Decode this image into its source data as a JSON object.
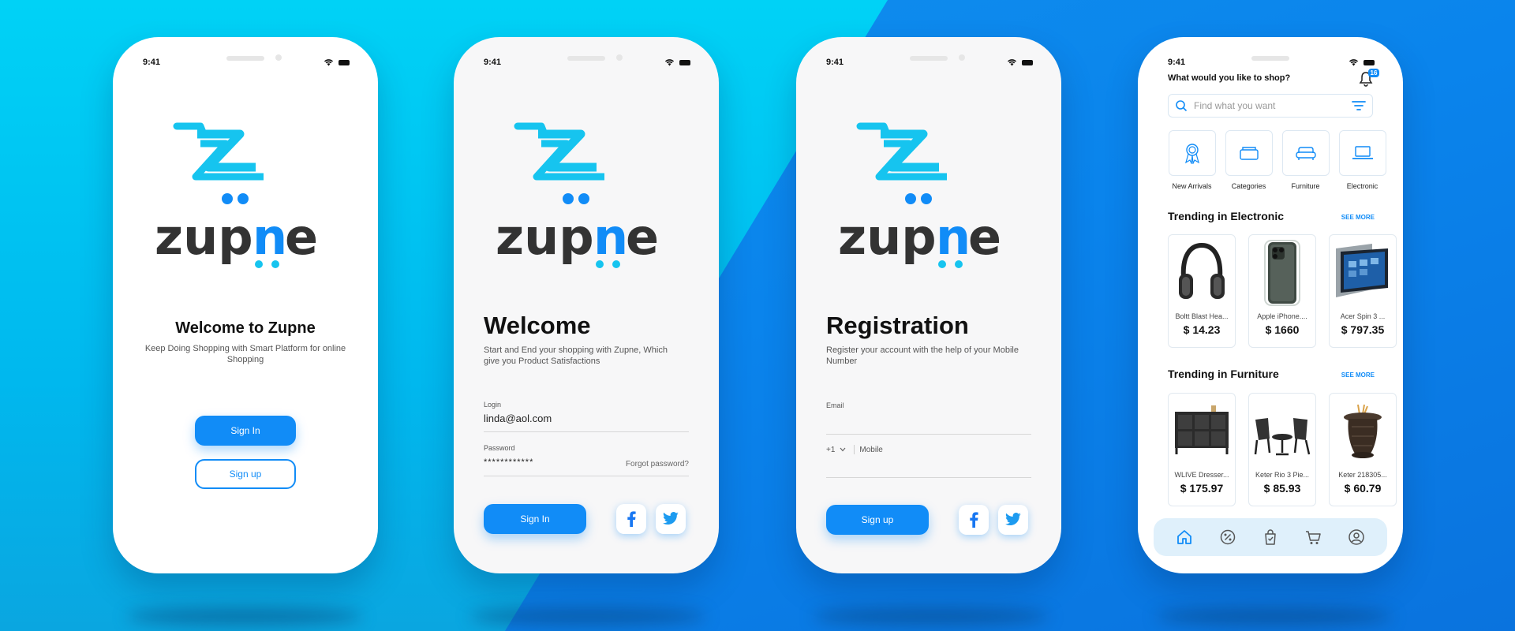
{
  "colors": {
    "accent": "#118cf7",
    "logo_cyan": "#16c4ef",
    "logo_dark": "#333333"
  },
  "status": {
    "time": "9:41"
  },
  "brand": {
    "name_start": "zup",
    "name_n": "n",
    "name_end": "e"
  },
  "welcome_screen": {
    "title": "Welcome to Zupne",
    "subtitle": "Keep Doing Shopping with Smart Platform for online Shopping",
    "sign_in": "Sign In",
    "sign_up": "Sign up"
  },
  "login_screen": {
    "title": "Welcome",
    "subtitle": "Start and End your shopping with Zupne, Which give you Product Satisfactions",
    "login_label": "Login",
    "login_value": "linda@aol.com",
    "password_label": "Password",
    "password_value": "************",
    "forgot": "Forgot password?",
    "sign_in": "Sign In",
    "facebook_icon": "facebook-icon",
    "twitter_icon": "twitter-icon"
  },
  "register_screen": {
    "title": "Registration",
    "subtitle": "Register your account with the help of your Mobile Number",
    "email_label": "Email",
    "country_code": "+1",
    "mobile_placeholder": "Mobile",
    "sign_up": "Sign up"
  },
  "shop_screen": {
    "question": "What would you like to shop?",
    "notification_count": "16",
    "search_placeholder": "Find what you want",
    "categories": [
      {
        "label": "New Arrivals",
        "icon": "award-icon"
      },
      {
        "label": "Categories",
        "icon": "box-icon"
      },
      {
        "label": "Furniture",
        "icon": "sofa-icon"
      },
      {
        "label": "Electronic",
        "icon": "laptop-icon"
      }
    ],
    "sections": [
      {
        "title": "Trending in Electronic",
        "see_more": "SEE MORE",
        "products": [
          {
            "name": "Boltt Blast Hea...",
            "price": "$ 14.23"
          },
          {
            "name": "Apple iPhone....",
            "price": "$ 1660"
          },
          {
            "name": "Acer Spin 3 ...",
            "price": "$ 797.35"
          }
        ]
      },
      {
        "title": "Trending in Furniture",
        "see_more": "SEE MORE",
        "products": [
          {
            "name": "WLIVE Dresser...",
            "price": "$ 175.97"
          },
          {
            "name": "Keter Rio 3 Pie...",
            "price": "$ 85.93"
          },
          {
            "name": "Keter 218305...",
            "price": "$ 60.79"
          }
        ]
      }
    ],
    "nav": [
      "home-icon",
      "discount-icon",
      "bag-icon",
      "cart-icon",
      "profile-icon"
    ]
  }
}
